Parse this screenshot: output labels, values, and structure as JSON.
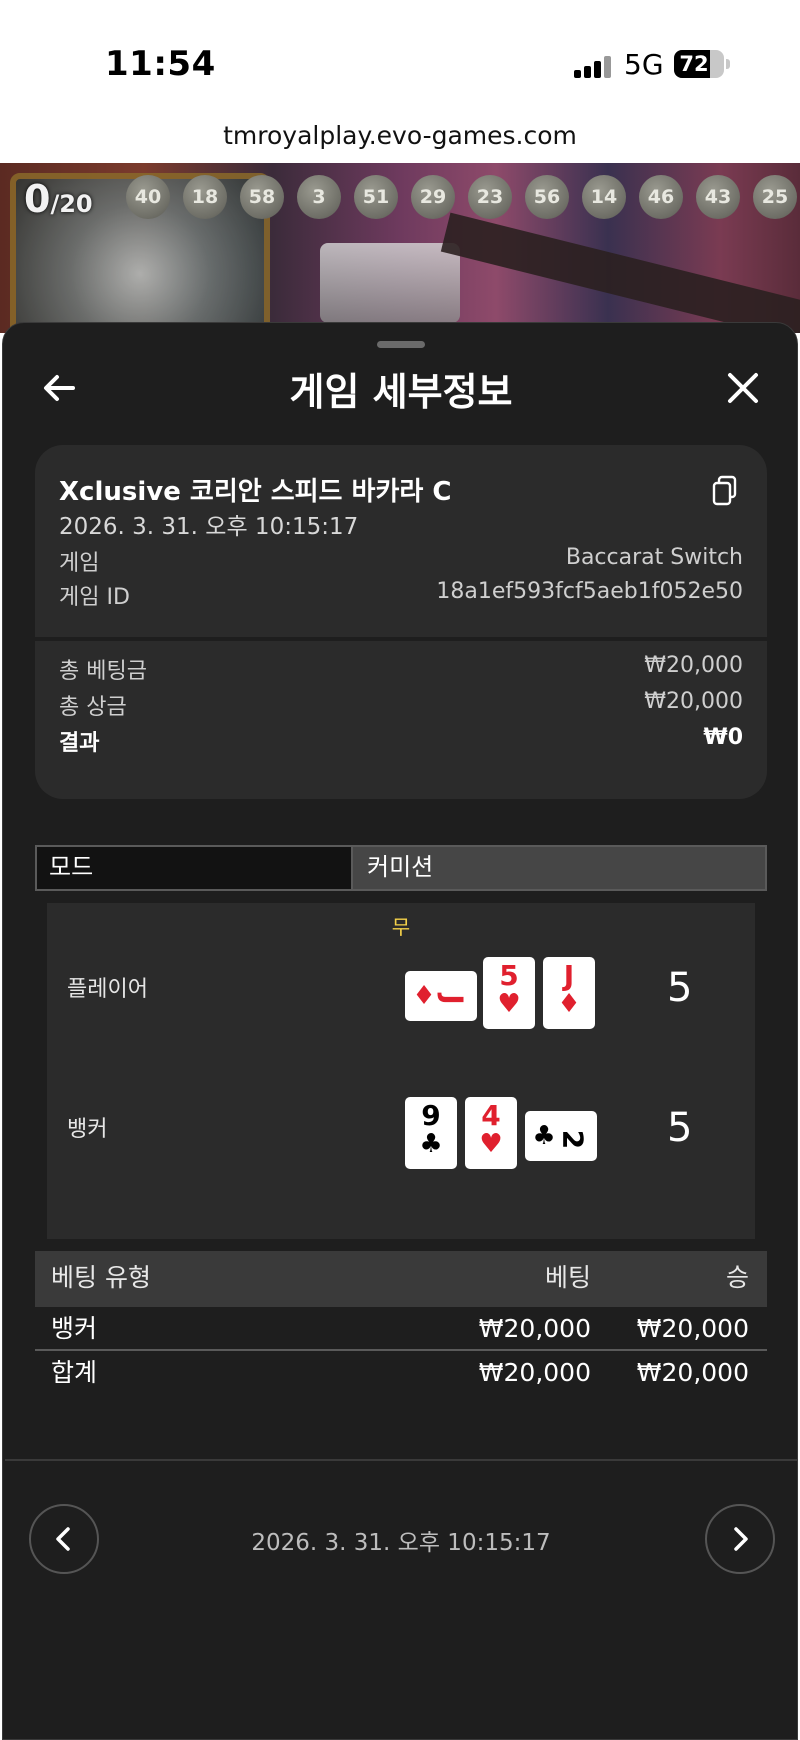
{
  "status": {
    "time": "11:54",
    "network": "5G",
    "battery": "72",
    "battery_level": 0.72
  },
  "browser": {
    "url": "tmroyalplay.evo-games.com"
  },
  "stream": {
    "ball_counter_main": "0",
    "ball_counter_total": "/20",
    "balls": [
      "40",
      "18",
      "58",
      "3",
      "51",
      "29",
      "23",
      "56",
      "14",
      "46",
      "43",
      "25"
    ]
  },
  "sheet": {
    "title": "게임 세부정보"
  },
  "game": {
    "name": "Xclusive 코리안 스피드 바카라 C",
    "datetime": "2026. 3. 31. 오후 10:15:17",
    "game_label": "게임",
    "game_value": "Baccarat Switch",
    "id_label": "게임 ID",
    "id_value": "18a1ef593fcf5aeb1f052e50"
  },
  "summary": {
    "total_bet_label": "총 베팅금",
    "total_bet_value": "₩20,000",
    "total_win_label": "총 상금",
    "total_win_value": "₩20,000",
    "result_label": "결과",
    "result_value": "₩0"
  },
  "mode": {
    "label": "모드",
    "value": "커미션"
  },
  "result": {
    "outcome": "무",
    "player": {
      "label": "플레이어",
      "score": "5",
      "cards": [
        {
          "rank": "J",
          "suit": "♦",
          "color": "red",
          "sideways": true
        },
        {
          "rank": "5",
          "suit": "♥",
          "color": "red",
          "sideways": false
        },
        {
          "rank": "J",
          "suit": "♦",
          "color": "red",
          "sideways": false
        }
      ]
    },
    "banker": {
      "label": "뱅커",
      "score": "5",
      "cards": [
        {
          "rank": "9",
          "suit": "♣",
          "color": "black",
          "sideways": false
        },
        {
          "rank": "4",
          "suit": "♥",
          "color": "red",
          "sideways": false
        },
        {
          "rank": "2",
          "suit": "♣",
          "color": "black",
          "sideways": true
        }
      ]
    }
  },
  "bets": {
    "headers": {
      "type": "베팅 유형",
      "bet": "베팅",
      "win": "승"
    },
    "rows": [
      {
        "type": "뱅커",
        "bet": "₩20,000",
        "win": "₩20,000"
      }
    ],
    "total": {
      "type": "합계",
      "bet": "₩20,000",
      "win": "₩20,000"
    }
  },
  "footer": {
    "datetime": "2026. 3. 31. 오후 10:15:17"
  },
  "colors": {
    "sheet_bg": "#1e1e1e",
    "card_bg": "#2b2b2b",
    "tie_yellow": "#f5d24a",
    "suit_red": "#e0202e"
  }
}
